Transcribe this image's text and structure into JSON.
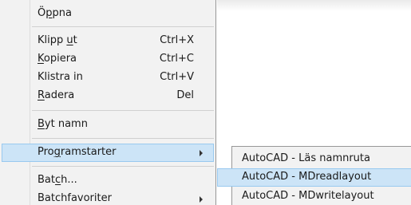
{
  "context_menu": {
    "items": [
      {
        "pre": "Ö",
        "ul": "p",
        "post": "pna",
        "shortcut": ""
      },
      {
        "pre": "Klipp ",
        "ul": "u",
        "post": "t",
        "shortcut": "Ctrl+X"
      },
      {
        "pre": "",
        "ul": "K",
        "post": "opiera",
        "shortcut": "Ctrl+C"
      },
      {
        "pre": "Klistra in",
        "ul": "",
        "post": "",
        "shortcut": "Ctrl+V"
      },
      {
        "pre": "",
        "ul": "R",
        "post": "adera",
        "shortcut": "Del"
      },
      {
        "pre": "",
        "ul": "B",
        "post": "yt namn",
        "shortcut": ""
      },
      {
        "pre": "Pro",
        "ul": "g",
        "post": "ramstarter",
        "shortcut": "",
        "submenu": true,
        "highlighted": true
      },
      {
        "pre": "Bat",
        "ul": "c",
        "post": "h...",
        "shortcut": ""
      },
      {
        "pre": "Batchfavoriter",
        "ul": "",
        "post": "",
        "shortcut": "",
        "submenu": true
      }
    ]
  },
  "submenu": {
    "items": [
      {
        "label": "AutoCAD - Läs namnruta"
      },
      {
        "label": "AutoCAD - MDreadlayout",
        "highlighted": true
      },
      {
        "label": "AutoCAD - MDwritelayout"
      }
    ]
  },
  "colors": {
    "menu_background": "#f2f2f2",
    "highlight_fill": "#cce4f7",
    "highlight_border": "#99c9ef"
  }
}
